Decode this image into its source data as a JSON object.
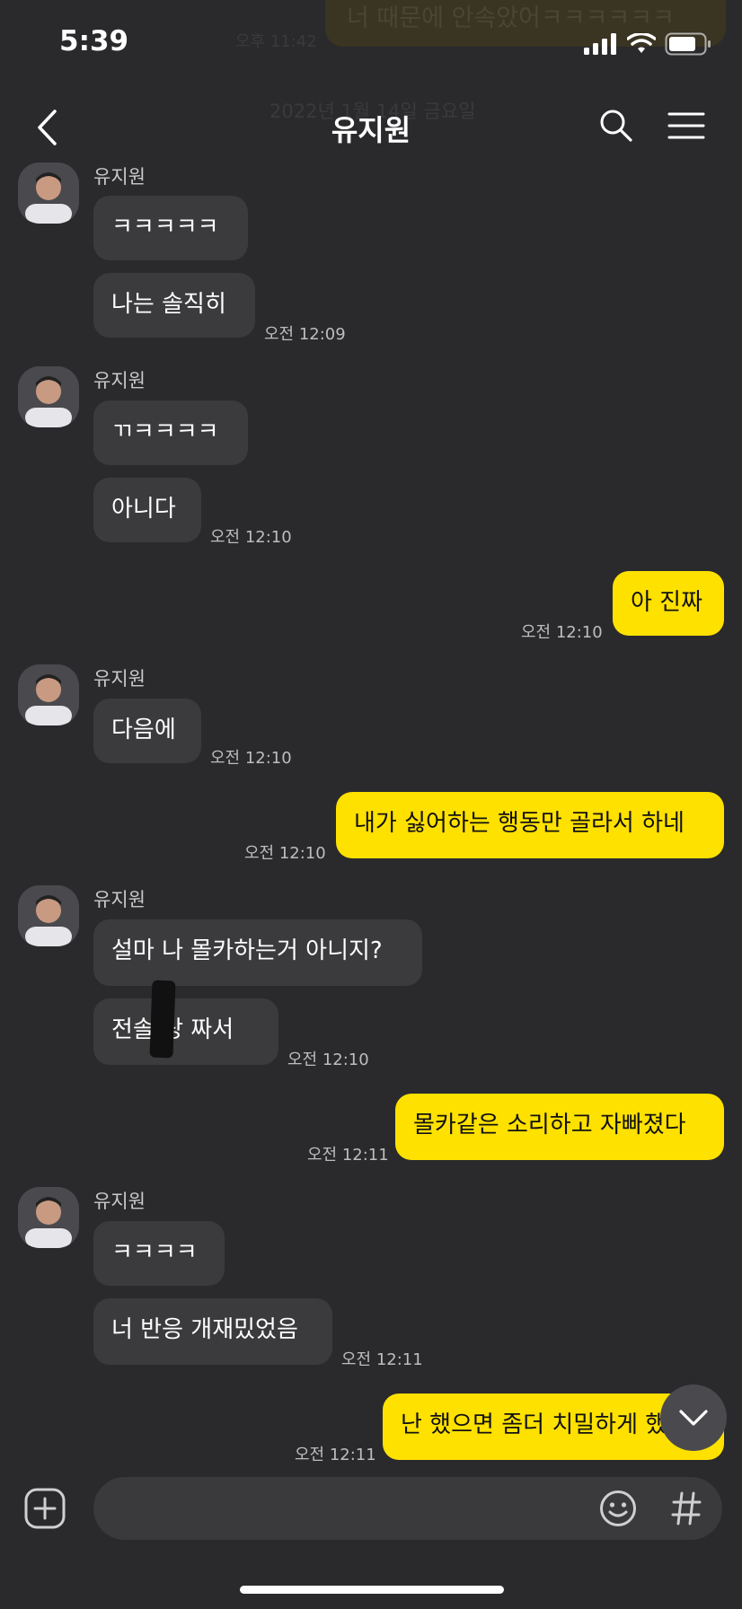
{
  "status_bar": {
    "time": "5:39"
  },
  "header": {
    "title": "유지원"
  },
  "background_ghost": {
    "bubble_text": "너 때문에 안속았어ㅋㅋㅋㅋㅋㅋ",
    "time": "오후 11:42",
    "date": "2022년 1월 14일 금요일"
  },
  "sender_name": "유지원",
  "messages": [
    {
      "group": 1,
      "text": "ㅋㅋㅋㅋㅋ"
    },
    {
      "group": 1,
      "text": "나는 솔직히",
      "time": "오전 12:09"
    },
    {
      "group": 2,
      "text": "ㄲㅋㅋㅋㅋ"
    },
    {
      "group": 2,
      "text": "아니다",
      "time": "오전 12:10"
    },
    {
      "mine": true,
      "text": "아 진짜",
      "time": "오전 12:10"
    },
    {
      "group": 3,
      "text": "다음에",
      "time": "오전 12:10"
    },
    {
      "mine": true,
      "text": "내가 싫어하는 행동만 골라서 하네",
      "time": "오전 12:10"
    },
    {
      "group": 4,
      "text": "설마 나 몰카하는거 아니지?"
    },
    {
      "group": 4,
      "text": "전솔 랑 짜서",
      "time": "오전 12:10"
    },
    {
      "mine": true,
      "text": "몰카같은 소리하고 자빠졌다",
      "time": "오전 12:11"
    },
    {
      "group": 5,
      "text": "ㅋㅋㅋㅋ"
    },
    {
      "group": 5,
      "text": "너 반응 개재밌었음",
      "time": "오전 12:11"
    },
    {
      "mine": true,
      "text": "난 했으면 좀더 치밀하게 했지",
      "time": "오전 12:11"
    }
  ],
  "colors": {
    "background": "#2a2a2c",
    "incoming_bubble": "#3b3b3e",
    "outgoing_bubble": "#ffe100"
  }
}
